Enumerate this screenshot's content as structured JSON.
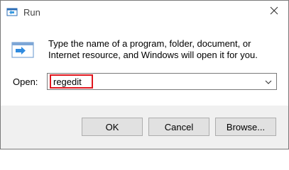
{
  "window": {
    "title": "Run",
    "title_icon": "run-icon",
    "close_icon": "close-icon"
  },
  "body": {
    "icon": "run-program-icon",
    "message": "Type the name of a program, folder, document, or Internet resource, and Windows will open it for you."
  },
  "open_field": {
    "label": "Open:",
    "value": "regedit",
    "dropdown_icon": "chevron-down-icon",
    "highlight_color": "#e0161e"
  },
  "buttons": {
    "ok": "OK",
    "cancel": "Cancel",
    "browse": "Browse..."
  }
}
